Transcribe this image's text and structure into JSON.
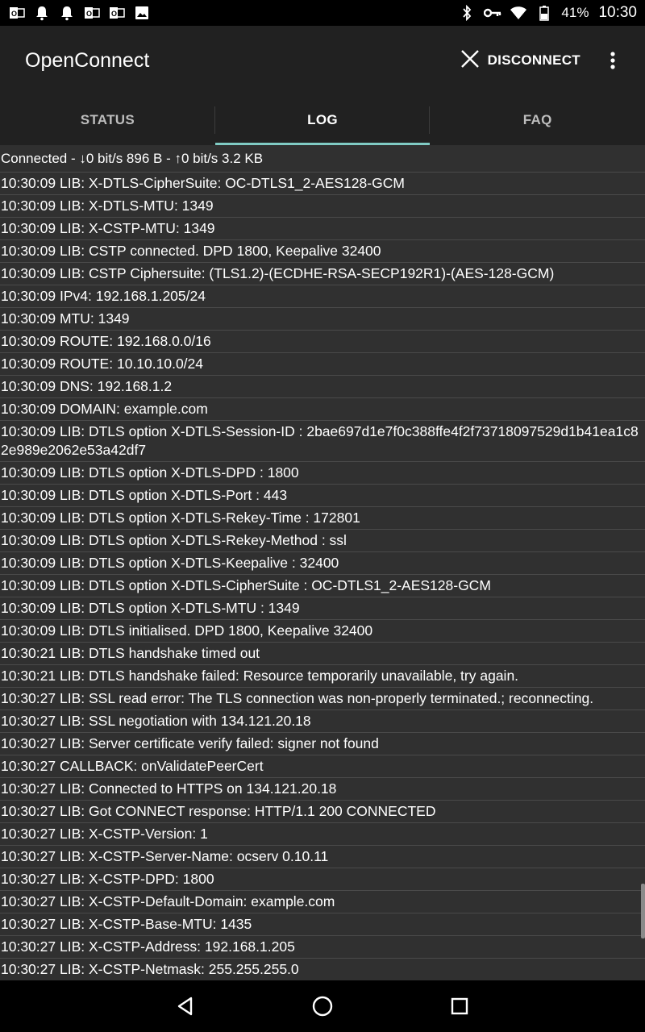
{
  "status_bar": {
    "notification_icons": [
      "outlook-icon",
      "bell-icon",
      "bell-icon",
      "outlook-icon",
      "outlook-icon",
      "image-icon"
    ],
    "battery": "41%",
    "time": "10:30"
  },
  "app_bar": {
    "title": "OpenConnect",
    "disconnect_label": "DISCONNECT"
  },
  "tabs": [
    {
      "label": "STATUS",
      "active": false
    },
    {
      "label": "LOG",
      "active": true
    },
    {
      "label": "FAQ",
      "active": false
    }
  ],
  "summary": "Connected - ↓0 bit/s 896 B - ↑0 bit/s 3.2 KB",
  "log_lines": [
    "10:30:09 LIB: X-DTLS-CipherSuite: OC-DTLS1_2-AES128-GCM",
    "10:30:09 LIB: X-DTLS-MTU: 1349",
    "10:30:09 LIB: X-CSTP-MTU: 1349",
    "10:30:09 LIB: CSTP connected. DPD 1800, Keepalive 32400",
    "10:30:09 LIB: CSTP Ciphersuite: (TLS1.2)-(ECDHE-RSA-SECP192R1)-(AES-128-GCM)",
    "10:30:09 IPv4: 192.168.1.205/24",
    "10:30:09 MTU: 1349",
    "10:30:09 ROUTE: 192.168.0.0/16",
    "10:30:09 ROUTE: 10.10.10.0/24",
    "10:30:09 DNS: 192.168.1.2",
    "10:30:09 DOMAIN: example.com",
    "10:30:09 LIB: DTLS option X-DTLS-Session-ID : 2bae697d1e7f0c388ffe4f2f73718097529d1b41ea1c82e989e2062e53a42df7",
    "10:30:09 LIB: DTLS option X-DTLS-DPD : 1800",
    "10:30:09 LIB: DTLS option X-DTLS-Port : 443",
    "10:30:09 LIB: DTLS option X-DTLS-Rekey-Time : 172801",
    "10:30:09 LIB: DTLS option X-DTLS-Rekey-Method : ssl",
    "10:30:09 LIB: DTLS option X-DTLS-Keepalive : 32400",
    "10:30:09 LIB: DTLS option X-DTLS-CipherSuite : OC-DTLS1_2-AES128-GCM",
    "10:30:09 LIB: DTLS option X-DTLS-MTU : 1349",
    "10:30:09 LIB: DTLS initialised. DPD 1800, Keepalive 32400",
    "10:30:21 LIB: DTLS handshake timed out",
    "10:30:21 LIB: DTLS handshake failed: Resource temporarily unavailable, try again.",
    "10:30:27 LIB: SSL read error: The TLS connection was non-properly terminated.; reconnecting.",
    "10:30:27 LIB: SSL negotiation with 134.121.20.18",
    "10:30:27 LIB: Server certificate verify failed: signer not found",
    "10:30:27 CALLBACK: onValidatePeerCert",
    "10:30:27 LIB: Connected to HTTPS on 134.121.20.18",
    "10:30:27 LIB: Got CONNECT response: HTTP/1.1 200 CONNECTED",
    "10:30:27 LIB: X-CSTP-Version: 1",
    "10:30:27 LIB: X-CSTP-Server-Name: ocserv 0.10.11",
    "10:30:27 LIB: X-CSTP-DPD: 1800",
    "10:30:27 LIB: X-CSTP-Default-Domain: example.com",
    "10:30:27 LIB: X-CSTP-Base-MTU: 1435",
    "10:30:27 LIB: X-CSTP-Address: 192.168.1.205",
    "10:30:27 LIB: X-CSTP-Netmask: 255.255.255.0"
  ],
  "colors": {
    "accent": "#80cbc4",
    "app_bar": "#212121",
    "background": "#303030"
  }
}
